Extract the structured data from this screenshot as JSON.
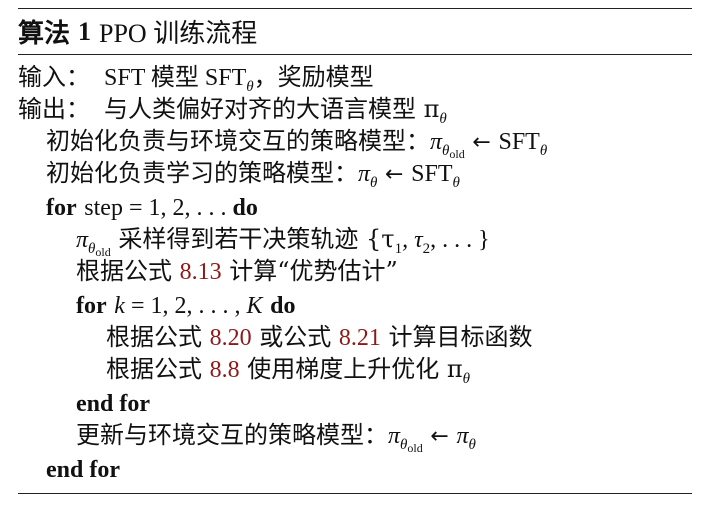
{
  "algorithm": {
    "label": "算法",
    "number": "1",
    "name": "PPO 训练流程"
  },
  "lines": [
    {
      "prefix": "输入：",
      "text": "SFT 模型 SFT",
      "sub": "θ",
      "tail": "，奖励模型"
    },
    {
      "prefix": "输出：",
      "text": "与人类偏好对齐的大语言模型 π",
      "sub": "θ"
    },
    {
      "text": "初始化负责与环境交互的策略模型：",
      "lhs": "π",
      "lhs_sub": "θ",
      "lhs_subsub": "old",
      "arrow": "←",
      "rhs": "SFT",
      "rhs_sub": "θ"
    },
    {
      "text": "初始化负责学习的策略模型：",
      "lhs": "π",
      "lhs_sub": "θ",
      "arrow": "←",
      "rhs": "SFT",
      "rhs_sub": "θ"
    },
    {
      "kw1": "for",
      "text": "step = 1, 2, . . . ",
      "kw2": "do"
    },
    {
      "lhs": "π",
      "lhs_sub": "θ",
      "lhs_subsub": "old",
      "text": " 采样得到若干决策轨迹 {τ",
      "s1": "1",
      "mid": ", τ",
      "s2": "2",
      "tail": ", . . . }"
    },
    {
      "text": "根据公式 ",
      "ref": "8.13",
      "tail": " 计算“优势估计”"
    },
    {
      "kw1": "for",
      "math": "k",
      "text": " = 1, 2, . . . , ",
      "math2": "K",
      "kw2": "do"
    },
    {
      "text": "根据公式 ",
      "ref": "8.20",
      "mid": " 或公式 ",
      "ref2": "8.21",
      "tail": " 计算目标函数"
    },
    {
      "text": "根据公式 ",
      "ref": "8.8",
      "tail": " 使用梯度上升优化 π",
      "sub": "θ"
    },
    {
      "kw": "end for"
    },
    {
      "text": "更新与环境交互的策略模型：",
      "lhs": "π",
      "lhs_sub": "θ",
      "lhs_subsub": "old",
      "arrow": "←",
      "rhs": "π",
      "rhs_sub": "θ"
    },
    {
      "kw": "end for"
    }
  ]
}
